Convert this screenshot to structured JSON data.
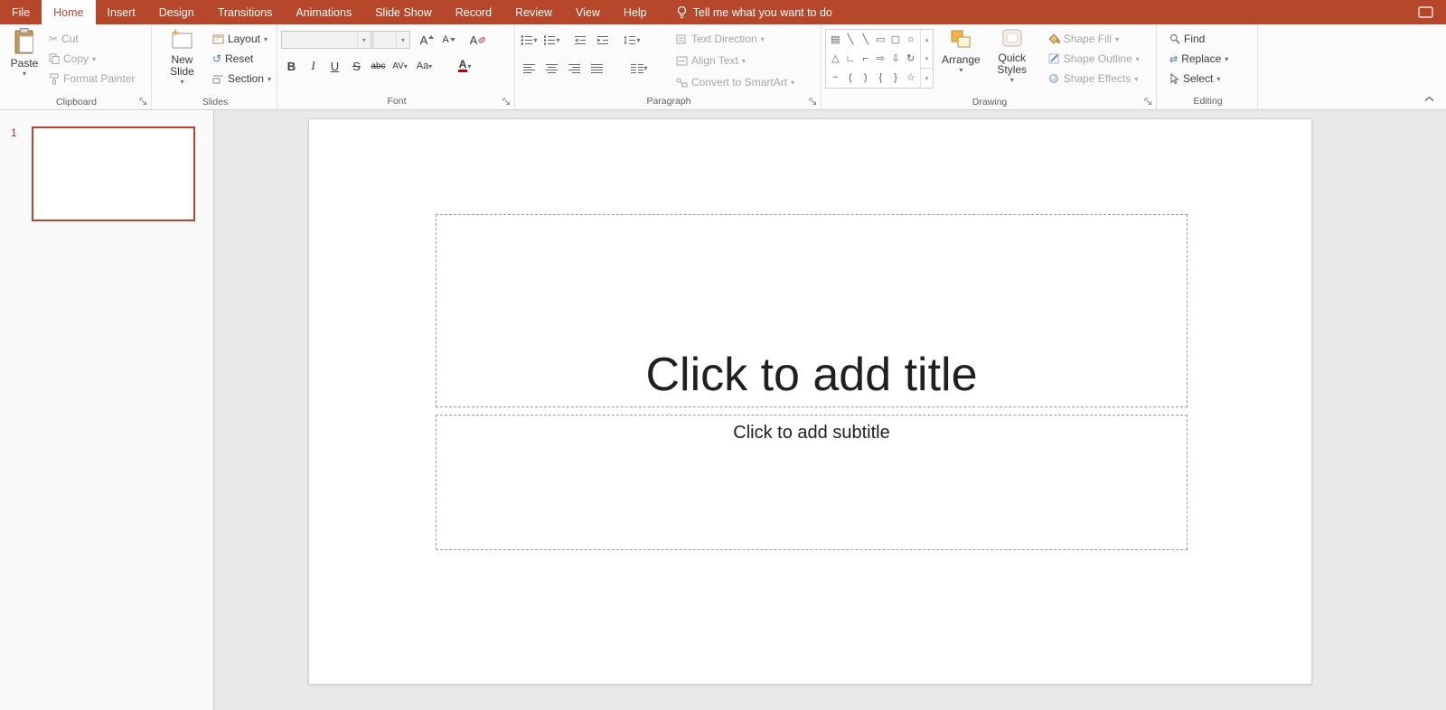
{
  "colors": {
    "accent": "#b7472a",
    "tab_bar": "#b7472a",
    "font_color_bar": "#c00000",
    "selection_border": "#b7472a"
  },
  "tabs": {
    "items": [
      "File",
      "Home",
      "Insert",
      "Design",
      "Transitions",
      "Animations",
      "Slide Show",
      "Record",
      "Review",
      "View",
      "Help"
    ],
    "active": "Home",
    "tell_me": "Tell me what you want to do"
  },
  "ribbon": {
    "clipboard": {
      "group_label": "Clipboard",
      "paste": "Paste",
      "cut": "Cut",
      "copy": "Copy",
      "format_painter": "Format Painter"
    },
    "slides": {
      "group_label": "Slides",
      "new_slide": "New Slide",
      "layout": "Layout",
      "reset": "Reset",
      "section": "Section"
    },
    "font": {
      "group_label": "Font",
      "bold": "B",
      "italic": "I",
      "underline": "U",
      "strikethrough": "S",
      "double_strike": "abc",
      "char_spacing": "AV",
      "change_case": "Aa",
      "font_color": "A",
      "grow_font": "A",
      "shrink_font": "A",
      "clear_format": "A"
    },
    "paragraph": {
      "group_label": "Paragraph",
      "text_direction": "Text Direction",
      "align_text": "Align Text",
      "convert_smartart": "Convert to SmartArt"
    },
    "drawing": {
      "group_label": "Drawing",
      "arrange": "Arrange",
      "quick_styles": "Quick Styles",
      "shape_fill": "Shape Fill",
      "shape_outline": "Shape Outline",
      "shape_effects": "Shape Effects"
    },
    "editing": {
      "group_label": "Editing",
      "find": "Find",
      "replace": "Replace",
      "select": "Select"
    }
  },
  "icons": {
    "chevron_down": "▾",
    "chevron_up": "▴",
    "scissors": "✂",
    "reset_arrow": "↺",
    "replace_arrows": "⇄",
    "shapes_r1": [
      "▤",
      "╲",
      "╲",
      "▭",
      "▢",
      "○"
    ],
    "shapes_r2": [
      "△",
      "∟",
      "⌐",
      "⇨",
      "⇩",
      "↻"
    ],
    "shapes_r3": [
      "~",
      "(",
      ")",
      "{",
      "}",
      "☆"
    ]
  },
  "panel": {
    "slide_number": "1"
  },
  "slide": {
    "title_placeholder": "Click to add title",
    "subtitle_placeholder": "Click to add subtitle"
  }
}
